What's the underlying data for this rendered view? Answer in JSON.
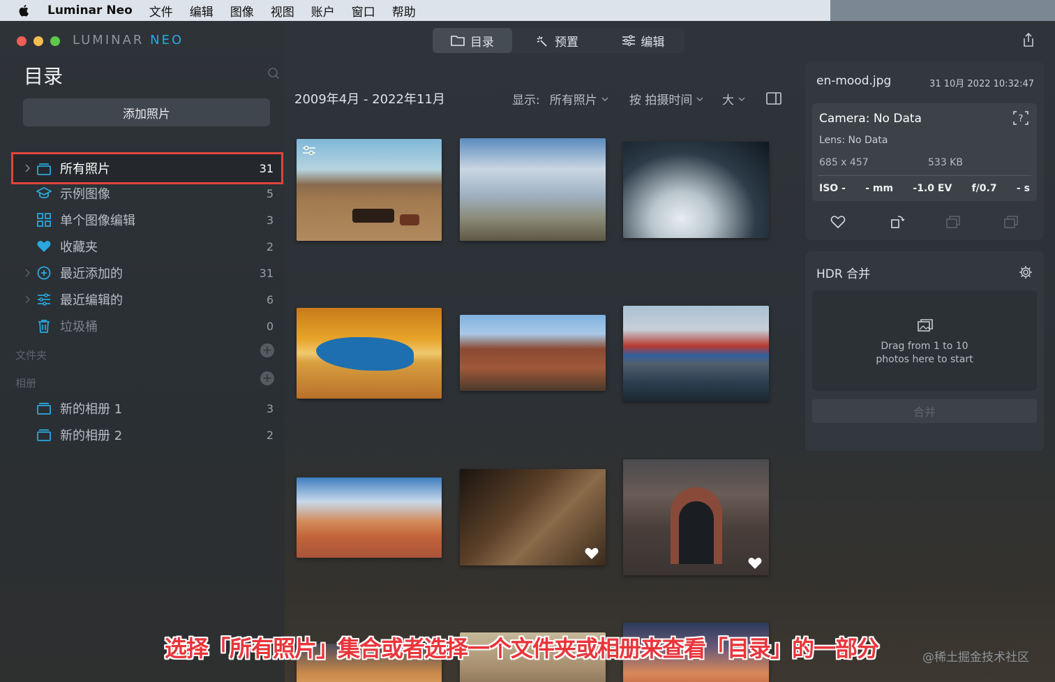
{
  "menubar": {
    "app_name": "Luminar Neo",
    "items": [
      "文件",
      "编辑",
      "图像",
      "视图",
      "账户",
      "窗口",
      "帮助"
    ]
  },
  "logo": {
    "part1": "LUMINAR",
    "part2": "NEO"
  },
  "tabs": [
    {
      "label": "目录",
      "icon": "folder-icon"
    },
    {
      "label": "预置",
      "icon": "sparkle-icon"
    },
    {
      "label": "编辑",
      "icon": "sliders-icon"
    }
  ],
  "sidebar": {
    "title": "目录",
    "add_button": "添加照片",
    "library": [
      {
        "label": "所有照片",
        "count": "31",
        "icon": "photos-stack-icon",
        "selected": true
      },
      {
        "label": "示例图像",
        "count": "5",
        "icon": "graduation-cap-icon"
      },
      {
        "label": "单个图像编辑",
        "count": "3",
        "icon": "grid-icon"
      },
      {
        "label": "收藏夹",
        "count": "2",
        "icon": "heart-icon"
      },
      {
        "label": "最近添加的",
        "count": "31",
        "icon": "plus-circle-icon"
      },
      {
        "label": "最近编辑的",
        "count": "6",
        "icon": "sliders-icon"
      },
      {
        "label": "垃圾桶",
        "count": "0",
        "icon": "trash-icon"
      }
    ],
    "folders_header": "文件夹",
    "albums_header": "相册",
    "albums": [
      {
        "label": "新的相册 1",
        "count": "3"
      },
      {
        "label": "新的相册 2",
        "count": "2"
      }
    ]
  },
  "gallery": {
    "date_range": "2009年4月 - 2022年11月",
    "show_label": "显示:",
    "show_value": "所有照片",
    "sort_label": "按 拍摄时间",
    "size_label": "大"
  },
  "info": {
    "file_name": "en-mood.jpg",
    "date": "31 10月 2022 10:32:47",
    "camera": "Camera: No Data",
    "lens": "Lens: No Data",
    "dimensions": "685 x 457",
    "size": "533 KB",
    "iso": "ISO -",
    "focal": "- mm",
    "ev": "-1.0 EV",
    "aperture": "f/0.7",
    "shutter": "- s"
  },
  "hdr": {
    "title": "HDR 合并",
    "drop_line1": "Drag from 1 to 10",
    "drop_line2": "photos here to start",
    "merge_button": "合并"
  },
  "caption": "选择「所有照片」集合或者选择一个文件夹或相册来查看「目录」的一部分",
  "watermark": "@稀土掘金技术社区",
  "colors": {
    "accent": "#2aa8df",
    "highlight": "#e0453c"
  }
}
